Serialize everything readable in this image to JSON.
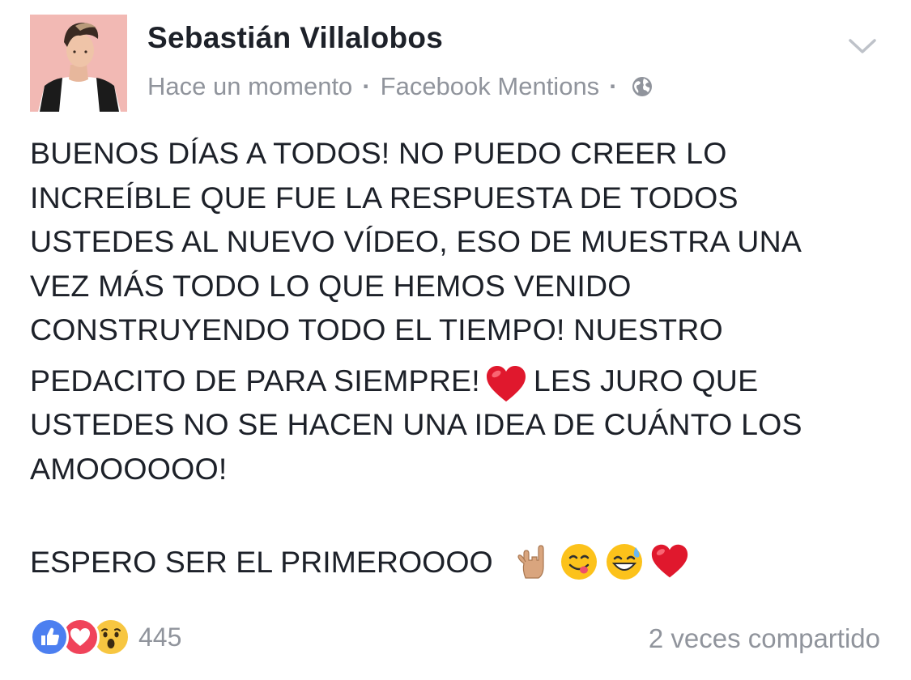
{
  "post": {
    "author": "Sebastián Villalobos",
    "timestamp": "Hace un momento",
    "source": "Facebook Mentions",
    "separator": "·",
    "privacy_icon": "globe-icon",
    "menu_icon": "chevron-down-icon",
    "body_lines": [
      "BUENOS DÍAS A TODOS! NO PUEDO CREER LO",
      "INCREÍBLE QUE FUE LA RESPUESTA DE TODOS",
      "USTEDES AL NUEVO VÍDEO, ESO DE MUESTRA UNA",
      "VEZ MÁS TODO LO QUE HEMOS VENIDO",
      "CONSTRUYENDO TODO EL TIEMPO! NUESTRO"
    ],
    "body_line6_before": "PEDACITO DE PARA SIEMPRE!",
    "body_line6_after": "LES JURO QUE",
    "body_lines_end": [
      "USTEDES NO SE HACEN UNA IDEA DE CUÁNTO LOS",
      "AMOOOOOO!"
    ],
    "second_paragraph": "ESPERO SER EL PRIMEROOOO",
    "emojis": [
      "red-heart-emoji",
      "rock-on-hand-emoji",
      "yum-face-emoji",
      "sweat-smile-emoji",
      "red-heart-emoji"
    ]
  },
  "footer": {
    "reaction_icons": [
      "like-icon",
      "love-icon",
      "wow-icon"
    ],
    "reaction_count": "445",
    "shares": "2 veces compartido"
  },
  "colors": {
    "text": "#1d2129",
    "meta": "#90949c",
    "like": "#4c7ff0",
    "love": "#f0435a",
    "wow": "#f7c641",
    "avatar_bg": "#f2b9b4"
  }
}
